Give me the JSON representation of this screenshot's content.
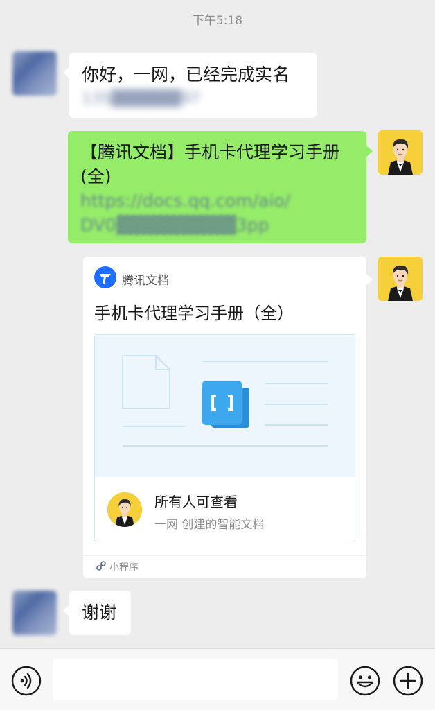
{
  "timestamp": "下午5:18",
  "messages": {
    "m1": {
      "line1": "你好，一网，已经完成实名",
      "line2": "135▓▓▓▓▓▓97"
    },
    "m2": {
      "line1": "【腾讯文档】手机卡代理学习手册",
      "line2": "(全)",
      "line3": "https://docs.qq.com/aio/",
      "line4": "DV0▓▓▓▓▓▓▓▓▓3pp"
    },
    "card": {
      "brand_icon": "tencent-docs-logo-icon",
      "brand_name": "腾讯文档",
      "title": "手机卡代理学习手册（全）",
      "permission": "所有人可查看",
      "creator": "一网 创建的智能文档",
      "source_icon": "mini-program-icon",
      "source_label": "小程序"
    },
    "m3": {
      "text": "谢谢"
    }
  },
  "input_bar": {
    "voice_icon": "voice-icon",
    "emoji_icon": "emoji-icon",
    "plus_icon": "plus-icon",
    "input_value": ""
  },
  "colors": {
    "background": "#ededed",
    "sent_bubble": "#95ec69",
    "received_bubble": "#ffffff",
    "link": "#576b95",
    "brand_blue": "#1e6fff"
  }
}
